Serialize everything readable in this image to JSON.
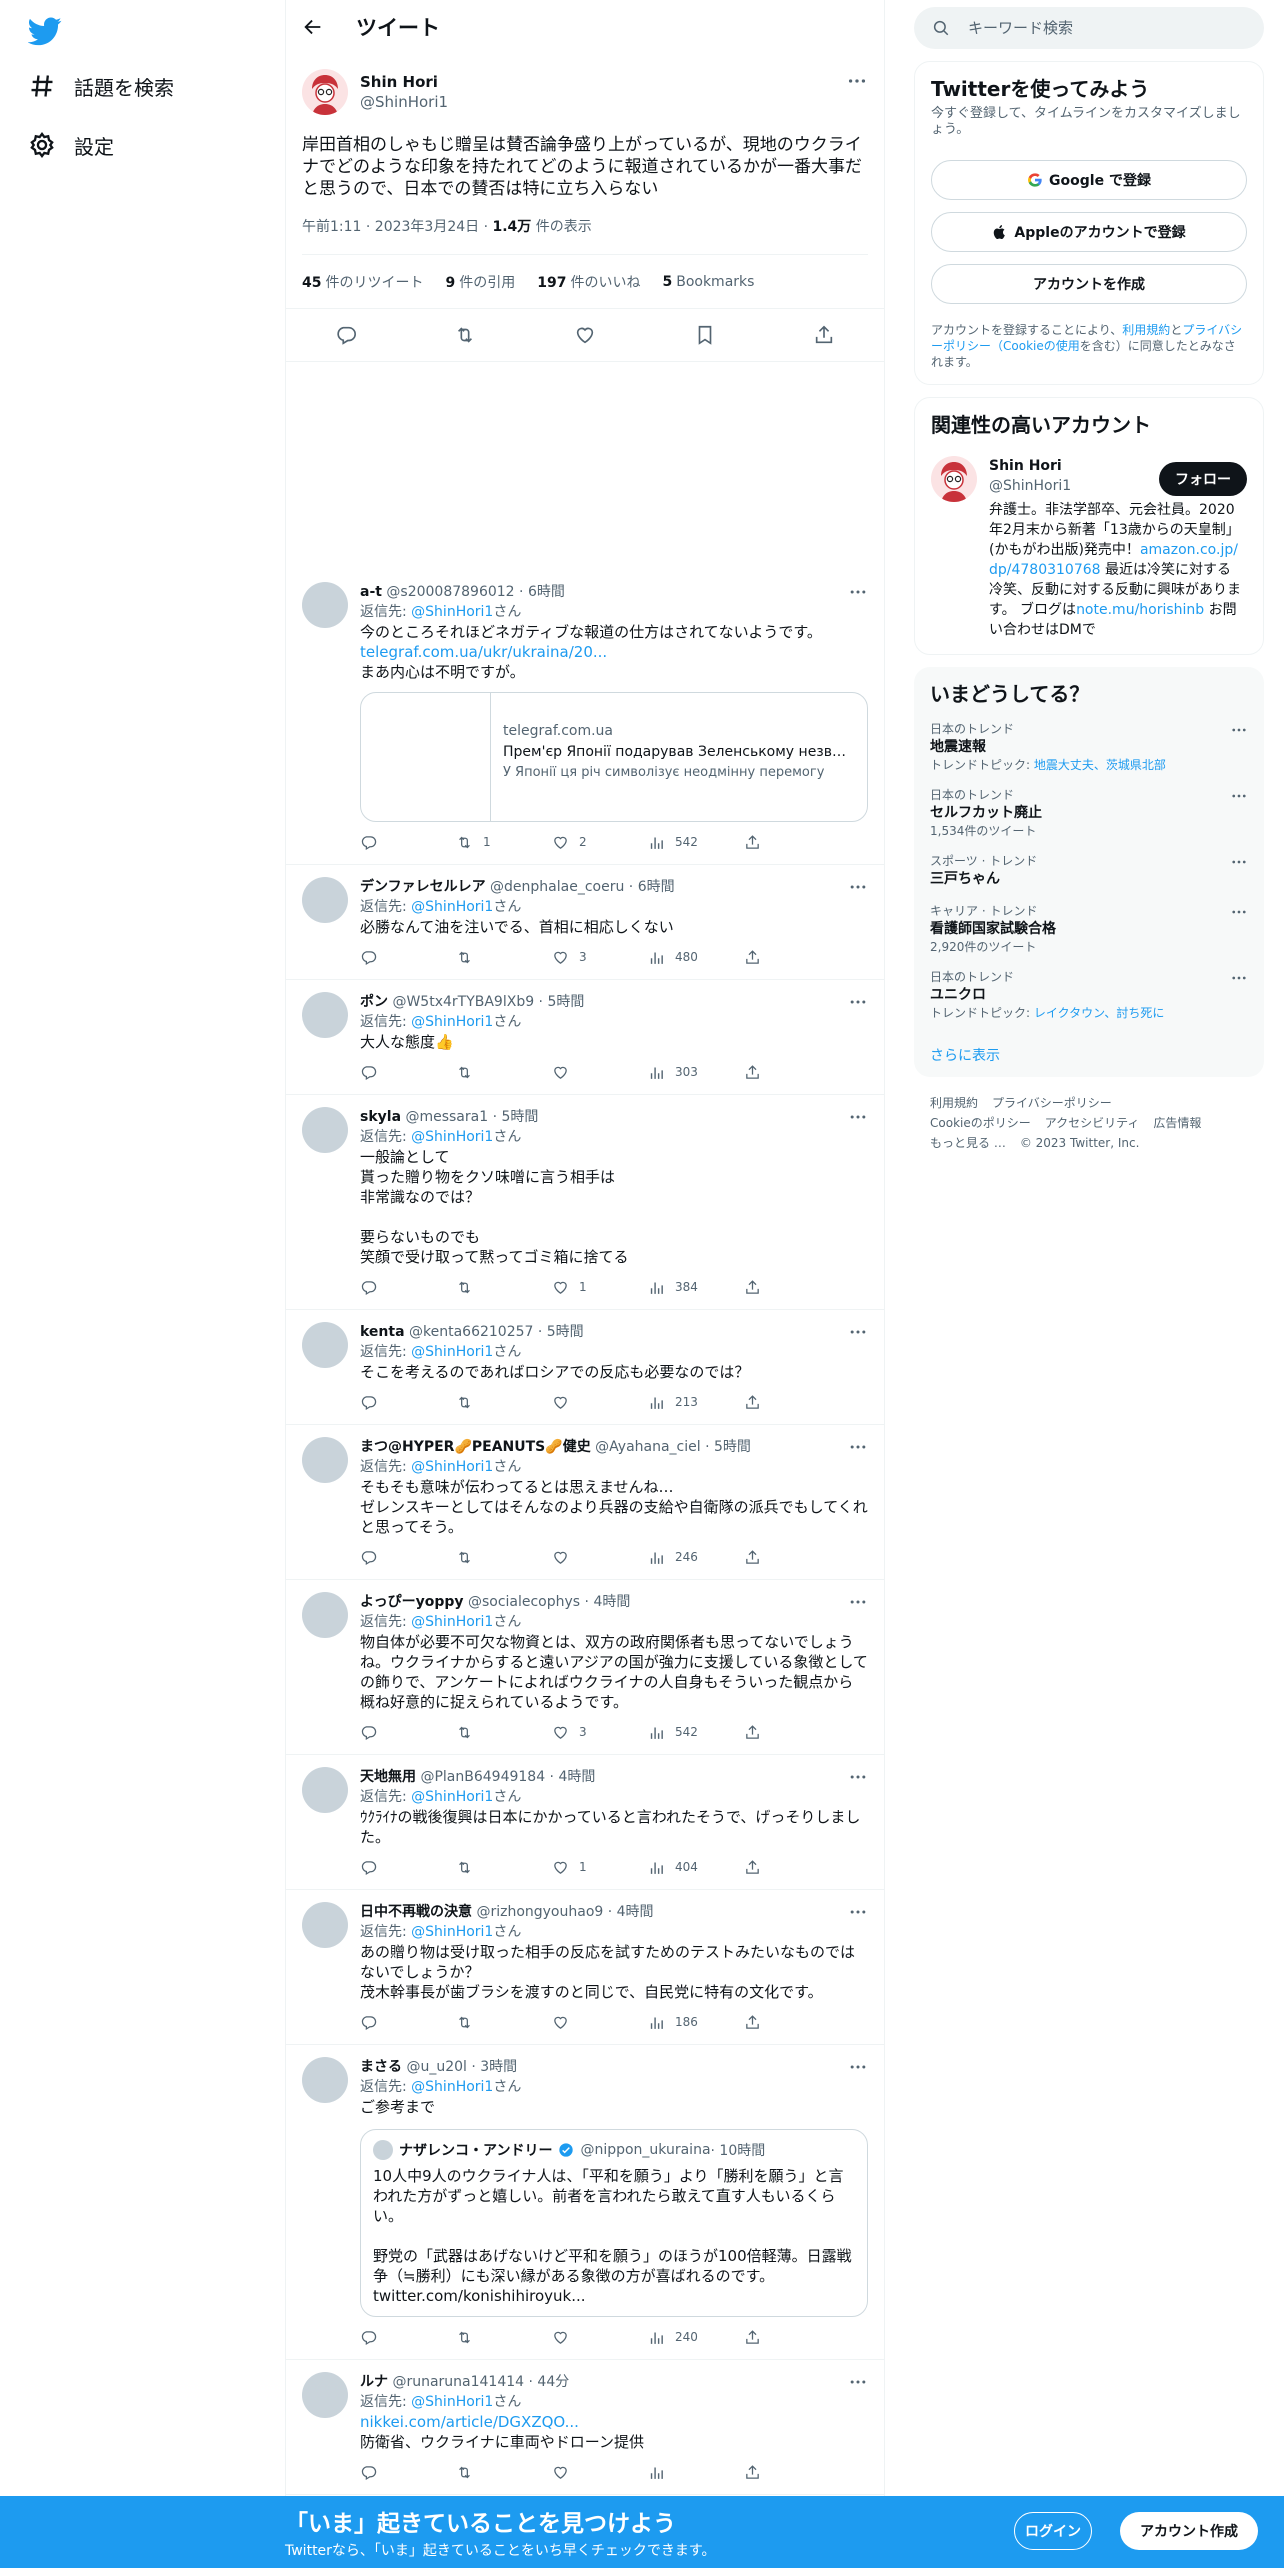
{
  "colors": {
    "accent": "#1d9bf0",
    "text": "#0f1419",
    "muted": "#536471",
    "border": "#eff3f4"
  },
  "nav": {
    "logo_icon": "twitter-bird-icon",
    "explore_label": "話題を検索",
    "settings_label": "設定"
  },
  "header": {
    "title": "ツイート",
    "back_icon": "arrow-left-icon"
  },
  "tweet": {
    "name": "Shin Hori",
    "handle": "@ShinHori1",
    "text": "岸田首相のしゃもじ贈呈は賛否論争盛り上がっているが、現地のウクライナでどのような印象を持たれてどのように報道されているかが一番大事だと思うので、日本での賛否は特に立ち入らない",
    "time": "午前1:11 · 2023年3月24日 · ",
    "views_count": "1.4万",
    "views_label": " 件の表示",
    "retweets": "45",
    "retweets_label": "件のリツイート",
    "quotes": "9",
    "quotes_label": "件の引用",
    "likes": "197",
    "likes_label": "件のいいね",
    "bookmarks": "5",
    "bookmarks_label": "Bookmarks"
  },
  "replies": [
    {
      "name": "a-t",
      "handle": "@s200087896012",
      "time": " · 6時間",
      "replyto_prefix": "返信先: ",
      "replyto": "@ShinHori1",
      "replyto_suffix": "さん",
      "text": "今のところそれほどネガティブな報道の仕方はされてないようです。",
      "link": "telegraf.com.ua/ukr/ukraina/20...",
      "text2": "まあ内心は不明ですが。",
      "card": {
        "domain": "telegraf.com.ua",
        "title": "Прем'єр Японії подарував Зеленському незвича...",
        "desc": "У Японії ця річ символізує неодмінну перемогу"
      },
      "replies": "",
      "retweets": "1",
      "likes": "2",
      "views": "542"
    },
    {
      "name": "デンファレセルレア",
      "handle": "@denphalae_coeru",
      "time": " · 6時間",
      "replyto_prefix": "返信先: ",
      "replyto": "@ShinHori1",
      "replyto_suffix": "さん",
      "text": "必勝なんて油を注いでる、首相に相応しくない",
      "replies": "",
      "retweets": "",
      "likes": "3",
      "views": "480"
    },
    {
      "name": "ポン",
      "handle": "@W5tx4rTYBA9lXb9",
      "time": " · 5時間",
      "replyto_prefix": "返信先: ",
      "replyto": "@ShinHori1",
      "replyto_suffix": "さん",
      "text": "大人な態度👍",
      "replies": "",
      "retweets": "",
      "likes": "",
      "views": "303"
    },
    {
      "name": "skyla",
      "handle": "@messara1",
      "time": " · 5時間",
      "replyto_prefix": "返信先: ",
      "replyto": "@ShinHori1",
      "replyto_suffix": "さん",
      "text": "一般論として\n貰った贈り物をクソ味噌に言う相手は\n非常識なのでは？\n\n要らないものでも\n笑顔で受け取って黙ってゴミ箱に捨てる",
      "replies": "",
      "retweets": "",
      "likes": "1",
      "views": "384"
    },
    {
      "name": "kenta",
      "handle": "@kenta66210257",
      "time": " · 5時間",
      "replyto_prefix": "返信先: ",
      "replyto": "@ShinHori1",
      "replyto_suffix": "さん",
      "text": "そこを考えるのであればロシアでの反応も必要なのでは？",
      "replies": "",
      "retweets": "",
      "likes": "",
      "views": "213"
    },
    {
      "name": "まつ@HYPER🥜PEANUTS🥜健史",
      "handle": "@Ayahana_ciel",
      "time": " · 5時間",
      "replyto_prefix": "返信先: ",
      "replyto": "@ShinHori1",
      "replyto_suffix": "さん",
      "text": "そもそも意味が伝わってるとは思えませんね…\nゼレンスキーとしてはそんなのより兵器の支給や自衛隊の派兵でもしてくれと思ってそう。",
      "replies": "",
      "retweets": "",
      "likes": "",
      "views": "246"
    },
    {
      "name": "よっぴーyoppy",
      "handle": "@socialecophys",
      "time": " · 4時間",
      "replyto_prefix": "返信先: ",
      "replyto": "@ShinHori1",
      "replyto_suffix": "さん",
      "text": "物自体が必要不可欠な物資とは、双方の政府関係者も思ってないでしょうね。ウクライナからすると遠いアジアの国が強力に支援している象徴としての飾りで、アンケートによればウクライナの人自身もそういった観点から概ね好意的に捉えられているようです。",
      "replies": "",
      "retweets": "",
      "likes": "3",
      "views": "542"
    },
    {
      "name": "天地無用",
      "handle": "@PlanB64949184",
      "time": " · 4時間",
      "replyto_prefix": "返信先: ",
      "replyto": "@ShinHori1",
      "replyto_suffix": "さん",
      "text": "ｳｸﾗｲﾅの戦後復興は日本にかかっていると言われたそうで、げっそりしました。",
      "replies": "",
      "retweets": "",
      "likes": "1",
      "views": "404"
    },
    {
      "name": "日中不再戦の決意",
      "handle": "@rizhongyouhao9",
      "time": " · 4時間",
      "replyto_prefix": "返信先: ",
      "replyto": "@ShinHori1",
      "replyto_suffix": "さん",
      "text": "あの贈り物は受け取った相手の反応を試すためのテストみたいなものではないでしょうか？\n茂木幹事長が歯ブラシを渡すのと同じで、自民党に特有の文化です。",
      "replies": "",
      "retweets": "",
      "likes": "",
      "views": "186"
    },
    {
      "name": "まさる",
      "handle": "@u_u20l",
      "time": " · 3時間",
      "replyto_prefix": "返信先: ",
      "replyto": "@ShinHori1",
      "replyto_suffix": "さん",
      "text": "ご参考まで",
      "quote": {
        "name": "ナザレンコ・アンドリー",
        "handle": "@nippon_ukuraina",
        "time": " · 10時間",
        "text": "10人中9人のウクライナ人は、「平和を願う」より「勝利を願う」と言われた方がずっと嬉しい。前者を言われたら敢えて直す人もいるくらい。\n\n野党の「武器はあげないけど平和を願う」のほうが100倍軽薄。日露戦争（≒勝利）にも深い縁がある象徴の方が喜ばれるのです。\ntwitter.com/konishihiroyuk..."
      },
      "replies": "",
      "retweets": "",
      "likes": "",
      "views": "240"
    },
    {
      "name": "ルナ",
      "handle": "@runaruna141414",
      "time": " · 44分",
      "replyto_prefix": "返信先: ",
      "replyto": "@ShinHori1",
      "replyto_suffix": "さん",
      "link": "nikkei.com/article/DGXZQO...",
      "text": "防衛省、ウクライナに車両やドローン提供",
      "replies": "",
      "retweets": "",
      "likes": "",
      "views": ""
    }
  ],
  "search": {
    "placeholder": "キーワード検索"
  },
  "signup_panel": {
    "title": "Twitterを使ってみよう",
    "subtitle": "今すぐ登録して、タイムラインをカスタマイズしましょう。",
    "google_label": "Google で登録",
    "apple_label": "Appleのアカウントで登録",
    "create_label": "アカウントを作成",
    "legal_1": "アカウントを登録することにより、",
    "legal_terms": "利用規約",
    "legal_2": "と",
    "legal_privacy": "プライバシーポリシー（Cookieの使用",
    "legal_3": "を含む）に同意したとみなされます。"
  },
  "relevant": {
    "title": "関連性の高いアカウント",
    "name": "Shin Hori",
    "handle": "@ShinHori1",
    "follow_label": "フォロー",
    "bio_1": "弁護士。非法学部卒、元会社員。2020年2月末から新著「13歳からの天皇制」(かもがわ出版)発売中！",
    "bio_link1": "amazon.co.jp/dp/4780310768",
    "bio_2": " 最近は冷笑に対する冷笑、反動に対する反動に興味があります。 ブログは",
    "bio_link2": "note.mu/horishinb",
    "bio_3": " お問い合わせはDMで"
  },
  "trends": {
    "title": "いまどうしてる？",
    "items": [
      {
        "category": "日本のトレンド",
        "name": "地震速報",
        "extra_prefix": "トレンドトピック: ",
        "extra_links": "地震大丈夫、茨城県北部",
        "extra": ""
      },
      {
        "category": "日本のトレンド",
        "name": "セルフカット廃止",
        "extra_prefix": "",
        "extra_links": "",
        "extra": "1,534件のツイート"
      },
      {
        "category": "スポーツ · トレンド",
        "name": "三戸ちゃん",
        "extra_prefix": "",
        "extra_links": "",
        "extra": ""
      },
      {
        "category": "キャリア · トレンド",
        "name": "看護師国家試験合格",
        "extra_prefix": "",
        "extra_links": "",
        "extra": "2,920件のツイート"
      },
      {
        "category": "日本のトレンド",
        "name": "ユニクロ",
        "extra_prefix": "トレンドトピック: ",
        "extra_links": "レイクタウン、討ち死に",
        "extra": ""
      }
    ],
    "show_more": "さらに表示"
  },
  "footer": {
    "terms": "利用規約",
    "privacy": "プライバシーポリシー",
    "cookie": "Cookieのポリシー",
    "accessibility": "アクセシビリティ",
    "ads": "広告情報",
    "more": "もっと見る …",
    "copyright": "© 2023 Twitter, Inc."
  },
  "bottombar": {
    "title": "「いま」起きていることを見つけよう",
    "subtitle": "Twitterなら、「いま」起きていることをいち早くチェックできます。",
    "login_label": "ログイン",
    "signup_label": "アカウント作成"
  }
}
